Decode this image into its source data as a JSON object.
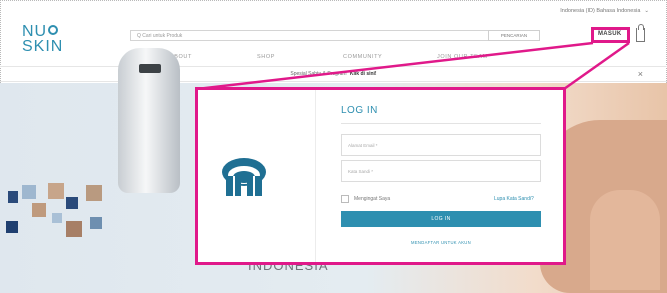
{
  "header": {
    "locale_selector": "Indonesia (ID) Bahasa Indonesia",
    "logo_line1": "NU",
    "logo_line2": "SKIN",
    "search": {
      "placeholder": "Q  Cari untuk Produk",
      "button_label": "PENCARIAN"
    },
    "login_link": "MASUK",
    "highlight_color": "#e0198a",
    "accent_color": "#2e8fb0"
  },
  "nav": {
    "items": [
      {
        "label": "ABOUT"
      },
      {
        "label": "SHOP"
      },
      {
        "label": "COMMUNITY"
      },
      {
        "label": "JOIN OUR TEAM"
      }
    ]
  },
  "promo": {
    "text": "Spesial Sabtu & Program",
    "link": "Klik di sini!"
  },
  "hero": {
    "text": "INDONESIA"
  },
  "login_modal": {
    "title": "LOG IN",
    "email_placeholder": "Alamat Email *",
    "password_placeholder": "Kata Sandi *",
    "remember_label": "Mengingat Saya",
    "forgot_link": "Lupa Kata Sandi?",
    "login_button": "LOG IN",
    "register_link": "MENDAFTAR UNTUK AKUN"
  }
}
